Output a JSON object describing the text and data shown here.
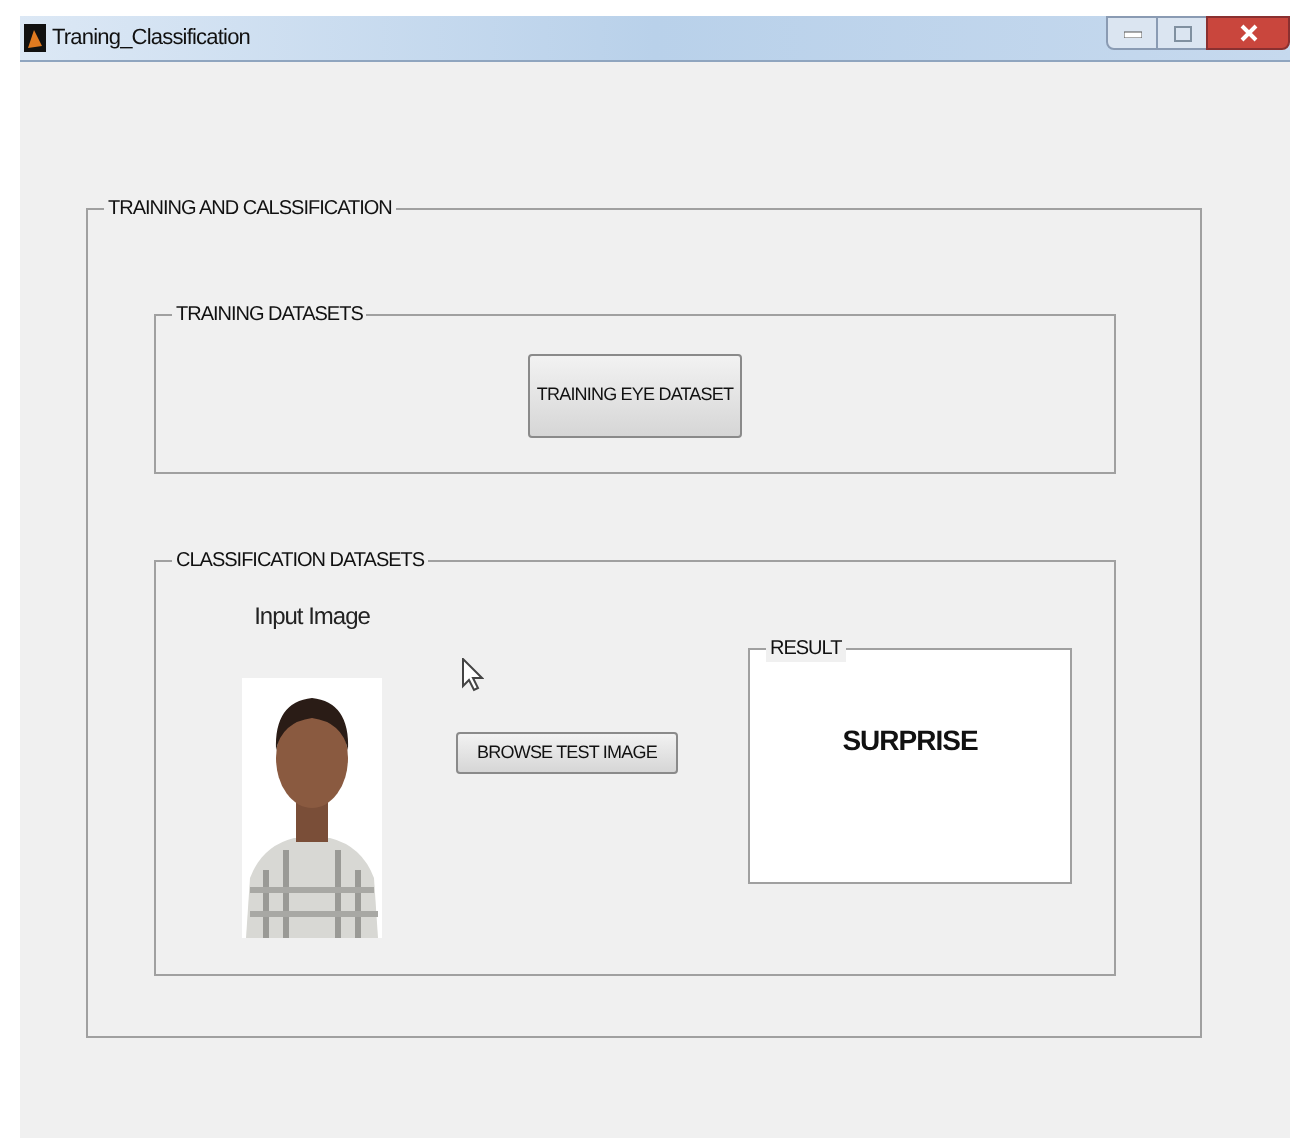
{
  "window": {
    "title": "Traning_Classification"
  },
  "main_panel": {
    "title": "TRAINING AND CALSSIFICATION",
    "training_panel": {
      "title": "TRAINING DATASETS",
      "button": "TRAINING EYE DATASET"
    },
    "classification_panel": {
      "title": "CLASSIFICATION DATASETS",
      "image_label": "Input Image",
      "button": "BROWSE TEST IMAGE",
      "result_panel": {
        "title": "RESULT",
        "value": "SURPRISE"
      }
    }
  }
}
